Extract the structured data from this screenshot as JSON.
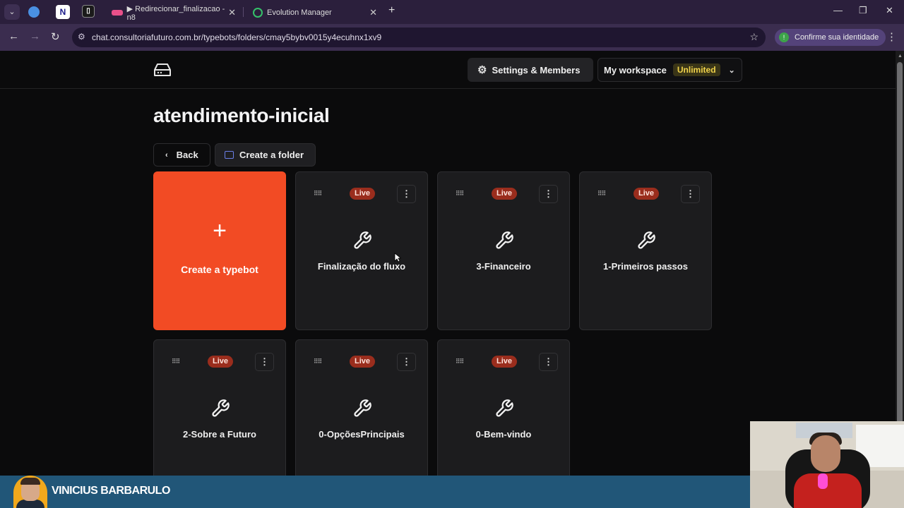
{
  "browser": {
    "tabs": [
      {
        "title": "▶ Redirecionar_finalizacao - n8",
        "active": false
      },
      {
        "title": "Evolution Manager",
        "active": false
      }
    ],
    "url": "chat.consultoriafuturo.com.br/typebots/folders/cmay5bybv0015y4ecuhnx1xv9",
    "identity_label": "Confirme sua identidade"
  },
  "header": {
    "settings_label": "Settings & Members",
    "workspace_label": "My workspace",
    "plan_badge": "Unlimited"
  },
  "page": {
    "title": "atendimento-inicial",
    "back_label": "Back",
    "create_folder_label": "Create a folder",
    "create_typebot_label": "Create a typebot"
  },
  "typebots": [
    {
      "name": "Finalização do fluxo",
      "status": "Live"
    },
    {
      "name": "3-Financeiro",
      "status": "Live"
    },
    {
      "name": "1-Primeiros passos",
      "status": "Live"
    },
    {
      "name": "2-Sobre a Futuro",
      "status": "Live"
    },
    {
      "name": "0-OpçõesPrincipais",
      "status": "Live"
    },
    {
      "name": "0-Bem-vindo",
      "status": "Live"
    }
  ],
  "overlay": {
    "presenter_name": "VINICIUS BARBARULO"
  },
  "colors": {
    "accent": "#f24b24",
    "live_badge": "#9a2d1d",
    "plan_badge_text": "#f0d24a",
    "lower_bar": "#215678"
  }
}
